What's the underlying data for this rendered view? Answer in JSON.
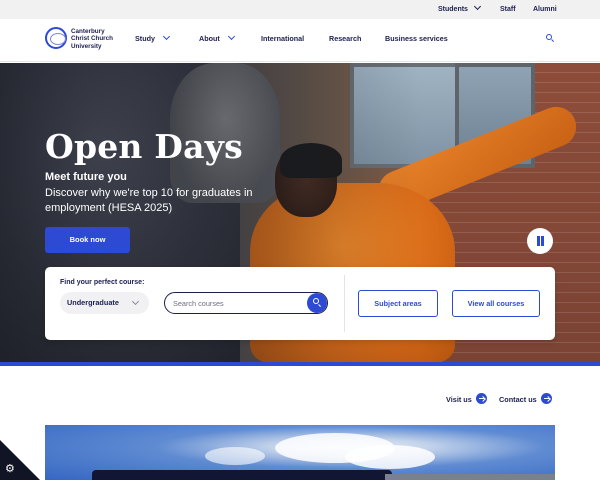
{
  "utility_nav": {
    "items": [
      {
        "label": "Students"
      },
      {
        "label": "Staff"
      },
      {
        "label": "Alumni"
      }
    ]
  },
  "header": {
    "logo": {
      "line1": "Canterbury",
      "line2": "Christ Church",
      "line3": "University",
      "icon": "ccu-logo-mark"
    },
    "nav": [
      {
        "label": "Study",
        "has_dropdown": true
      },
      {
        "label": "About",
        "has_dropdown": true
      },
      {
        "label": "International",
        "has_dropdown": false
      },
      {
        "label": "Research",
        "has_dropdown": false
      },
      {
        "label": "Business services",
        "has_dropdown": false
      }
    ],
    "search_icon": "search-icon"
  },
  "hero": {
    "title": "Open Days",
    "subtitle": "Meet future you",
    "text": "Discover why we're top 10 for graduates in employment (HESA 2025)",
    "cta": "Book now",
    "pause_icon": "pause-icon"
  },
  "course_finder": {
    "label": "Find your perfect course:",
    "level": "Undergraduate",
    "search_placeholder": "Search courses",
    "buttons": {
      "subject_areas": "Subject areas",
      "view_all": "View all courses"
    }
  },
  "quick_links": {
    "visit": "Visit us",
    "contact": "Contact us"
  },
  "colors": {
    "brand_blue": "#2c4ad4",
    "navy_text": "#1d1f4f",
    "utility_bg": "#f1f1f2"
  },
  "cookie": {
    "icon": "gear-icon"
  }
}
